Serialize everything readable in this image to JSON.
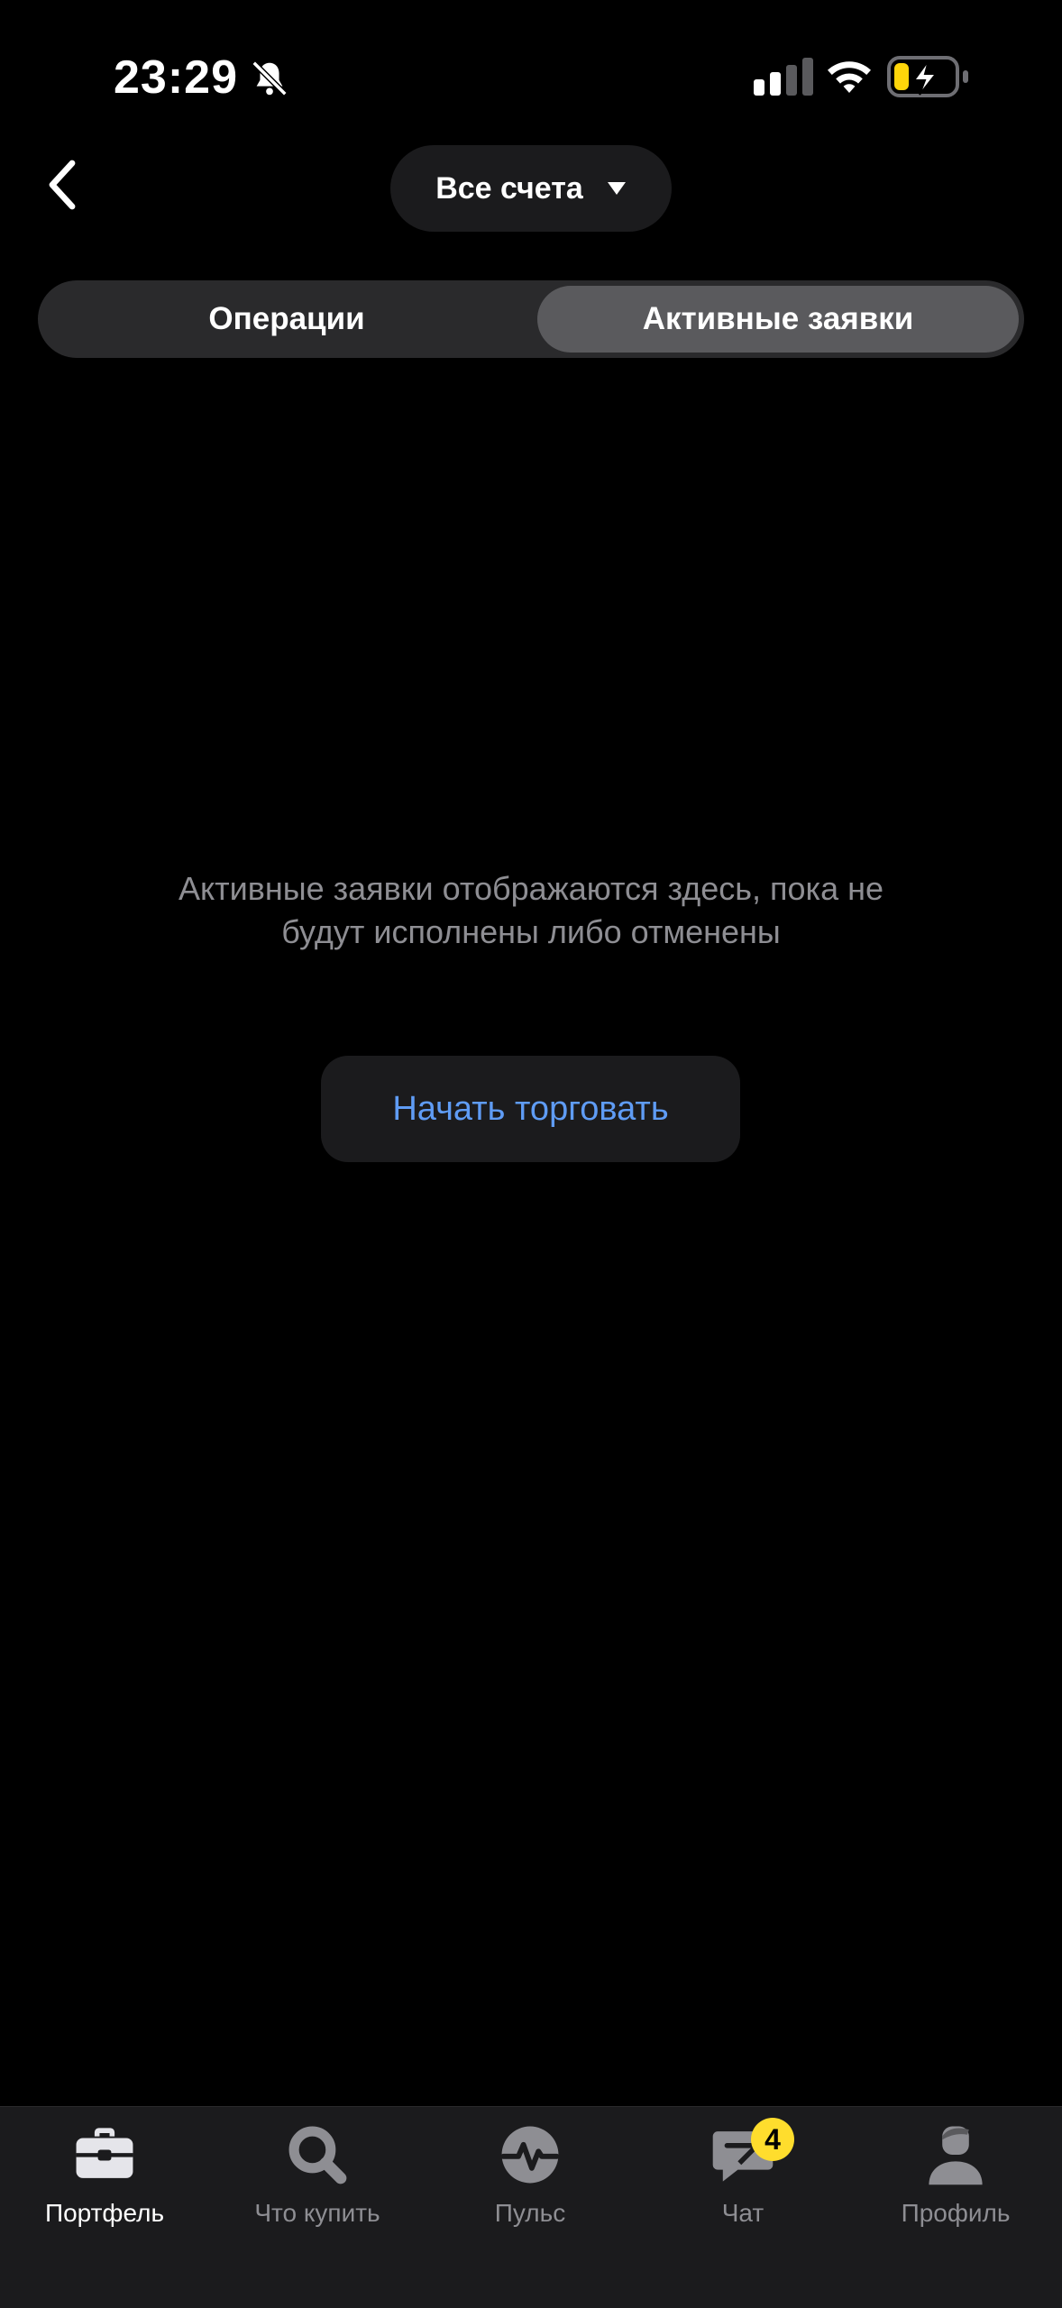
{
  "status_bar": {
    "time": "23:29",
    "icons": [
      "bell-slash-icon",
      "cellular-signal-icon",
      "wifi-icon",
      "battery-charging-icon"
    ],
    "battery_color": "#ffd60a"
  },
  "header": {
    "back_icon": "chevron-left-icon",
    "account_selector": {
      "label": "Все счета",
      "icon": "caret-down-icon"
    }
  },
  "segments": {
    "items": [
      {
        "label": "Операции",
        "selected": false
      },
      {
        "label": "Активные заявки",
        "selected": true
      }
    ]
  },
  "empty_state": {
    "message": "Активные заявки отображаются здесь, пока не будут исполнены либо отменены",
    "action_label": "Начать торговать"
  },
  "tab_bar": {
    "items": [
      {
        "label": "Портфель",
        "icon": "briefcase-icon",
        "active": true
      },
      {
        "label": "Что купить",
        "icon": "search-icon",
        "active": false
      },
      {
        "label": "Пульс",
        "icon": "pulse-icon",
        "active": false
      },
      {
        "label": "Чат",
        "icon": "chat-icon",
        "active": false,
        "badge": "4"
      },
      {
        "label": "Профиль",
        "icon": "profile-icon",
        "active": false
      }
    ]
  },
  "colors": {
    "background": "#000000",
    "surface": "#1b1b1d",
    "segment_selected": "#5a5a5d",
    "accent_link": "#5f9cf5",
    "muted_text": "#8e8e93",
    "badge": "#ffdd2d"
  }
}
